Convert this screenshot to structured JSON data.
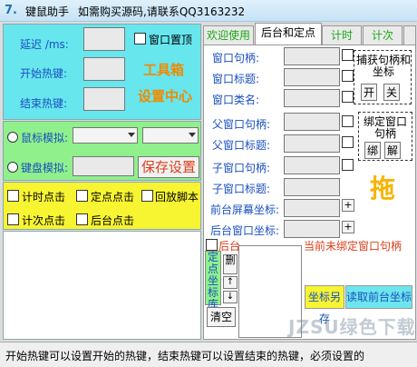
{
  "window": {
    "title": "键鼠助手",
    "subtitle": "如需购买源码,请联系QQ3163232"
  },
  "left": {
    "delay_label": "延迟 /ms:",
    "start_hotkey_label": "开始热键:",
    "end_hotkey_label": "结束热键:",
    "topmost_label": "窗口置顶",
    "toolbox_line1": "工具箱",
    "toolbox_line2": "设置中心",
    "mouse_sim_label": "鼠标模拟:",
    "keyboard_sim_label": "键盘模拟:",
    "save_settings": "保存设置",
    "timed_click": "计时点击",
    "fixed_click": "定点点击",
    "replay_script": "回放脚本",
    "count_click": "计次点击",
    "background_click": "后台点击"
  },
  "tabs": [
    {
      "label": "欢迎使用"
    },
    {
      "label": "后台和定点"
    },
    {
      "label": "计时"
    },
    {
      "label": "计次"
    }
  ],
  "right": {
    "window_handle": "窗口句柄:",
    "window_title": "窗口标题:",
    "window_class": "窗口类名:",
    "parent_handle": "父窗口句柄:",
    "parent_title": "父窗口标题:",
    "child_handle": "子窗口句柄:",
    "child_title": "子窗口标题:",
    "fg_screen_coord": "前台屏幕坐标:",
    "bg_window_coord": "后台窗口坐标:",
    "capture_box_title": "捕获句柄和坐标",
    "capture_on": "开",
    "capture_off": "关",
    "bind_box_title": "绑定窗口句柄",
    "bind_btn": "绑",
    "unbind_btn": "解",
    "drag_label": "拖",
    "background_label": "后台",
    "unbound_notice": "当前未绑定窗口句柄",
    "fixed_coord_list": "定点坐标库",
    "delete_btn": "删",
    "clear_btn": "清空",
    "coord_save_btn": "坐标另存",
    "read_bg_coord_btn": "读取前台坐标"
  },
  "status_bar": {
    "text": "开始热键可以设置开始的热键，结束热键可以设置结束的热键，必须设置的"
  },
  "watermark": "JZSU绿色下载"
}
